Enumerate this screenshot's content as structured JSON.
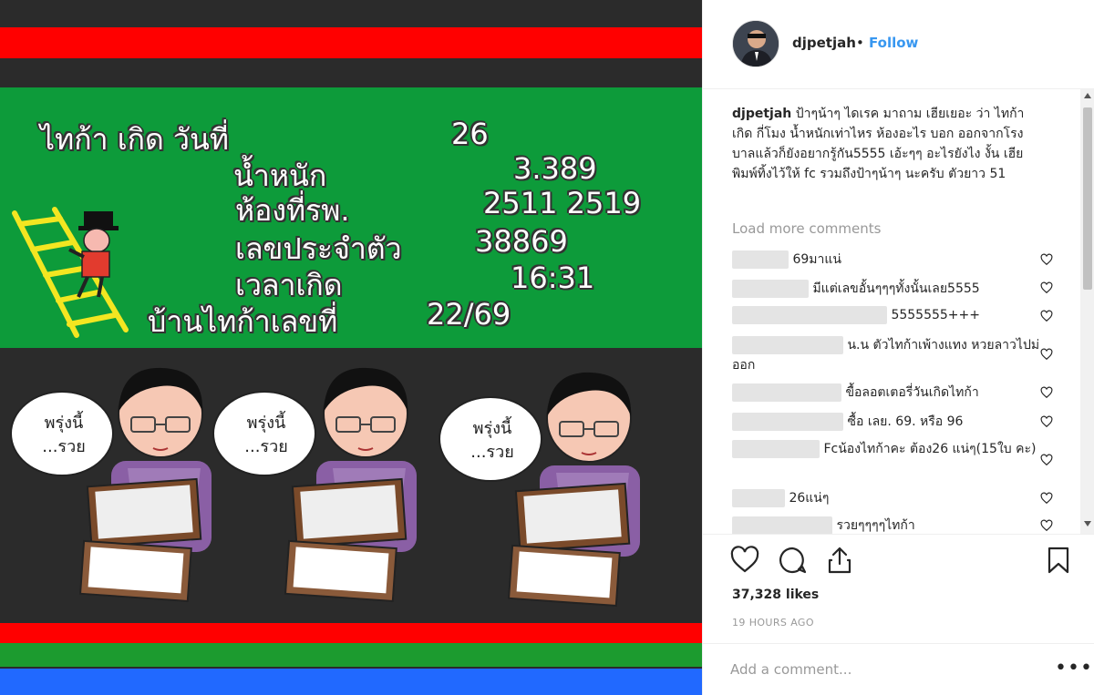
{
  "post": {
    "username": "djpetjah",
    "separator": "•",
    "follow_label": "Follow",
    "image_text": {
      "lines": [
        {
          "label": "ไทก้า เกิด  วันที่",
          "value": "26"
        },
        {
          "label": "น้ำหนัก",
          "value": "3.389"
        },
        {
          "label": "ห้องที่รพ.",
          "value": "2511  2519"
        },
        {
          "label": "เลขประจำตัว",
          "value": "38869"
        },
        {
          "label": "เวลาเกิด",
          "value": "16:31"
        },
        {
          "label": "บ้านไทก้าเลขที่",
          "value": "22/69"
        }
      ],
      "speech_bubble": "พรุ่งนี้\n...รวย"
    },
    "caption_user": "djpetjah",
    "caption_text": " ป้าๆน้าๆ ไดเรค มาถาม เฮียเยอะ ว่า ไทก้าเกิด กี่โมง น้ำหนักเท่าไหร ห้องอะไร บอก ออกจากโรงบาลแล้วก็ยังอยากรู้กัน5555 เอ้ะๆๆ อะไรยังไง งั้น เฮียพิมพ์ทิ้งไว้ให้ fc รวมถึงป้าๆน้าๆ นะครับ ตัวยาว 51",
    "load_more": "Load more comments",
    "comments": [
      {
        "text": "69มาแน่"
      },
      {
        "text": "มีแต่เลขอั้นๆๆๆทั้งนั้นเลย5555"
      },
      {
        "text": "5555555+++"
      },
      {
        "text": "น.น ตัวไทก้าเพ้างแทง หวยลาวไปม่ออก"
      },
      {
        "text": "ขื้อลอตเตอรี่วันเกิดไทก้า"
      },
      {
        "text": "ซื้อ เลย. 69. หรือ 96"
      },
      {
        "text": "Fcน้องไทก้าคะ ต้อง26 แน่ๆ(15ใบ คะ)"
      },
      {
        "text": "26แน่ๆ"
      },
      {
        "text": "รวยๆๆๆๆไทก้า"
      }
    ],
    "likes": "37,328 likes",
    "time": "19 HOURS AGO",
    "comment_placeholder": "Add a comment...",
    "more": "•••"
  },
  "icons": {
    "heart": "heart-icon",
    "comment": "comment-icon",
    "share": "share-icon",
    "bookmark": "bookmark-icon"
  },
  "colors": {
    "follow": "#3897f0",
    "stripe_red": "#ff0000",
    "stripe_green": "#1c9b2f",
    "stripe_blue": "#2169ff",
    "panel_green": "#0d9b3a",
    "panel_dark": "#2a2a2a"
  }
}
